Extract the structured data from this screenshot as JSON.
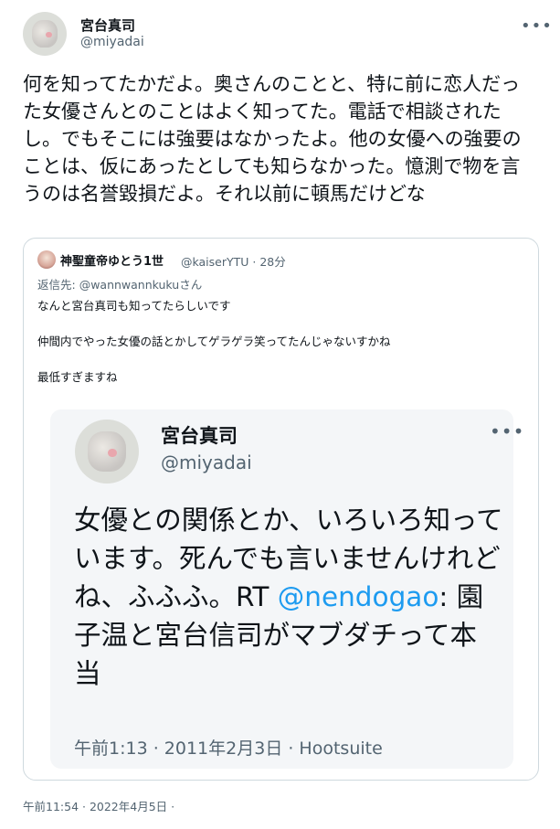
{
  "tweet": {
    "author_name": "宮台真司",
    "author_handle": "@miyadai",
    "more_icon": "more-icon",
    "text": "何を知ってたかだよ。奥さんのことと、特に前に恋人だった女優さんとのことはよく知ってた。電話で相談されたし。でもそこには強要はなかったよ。他の女優への強要のことは、仮にあったとしても知らなかった。憶測で物を言うのは名誉毀損だよ。それ以前に頓馬だけどな",
    "timestamp": "午前11:54 · 2022年4月5日 ·"
  },
  "quote": {
    "author_name": "神聖童帝ゆとう1世",
    "author_handle": "@kaiserYTU · 28分",
    "reply_prefix": "返信先: ",
    "reply_to": "@wannwannkukuさん",
    "line1": "なんと宮台真司も知ってたらしいです",
    "line2": "仲間内でやった女優の話とかしてゲラゲラ笑ってたんじゃないすかね",
    "line3": "最低すぎますね",
    "embedded": {
      "author_name": "宮台真司",
      "author_handle": "@miyadai",
      "text_before": "女優との関係とか、いろいろ知っています。死んでも言いませんけれどね、ふふふ。RT ",
      "mention": "@nendogao",
      "text_after": ": 園子温と宮台信司がマブダチって本当",
      "meta": "午前1:13 · 2011年2月3日 · Hootsuite"
    }
  },
  "colors": {
    "accent": "#1d9bf0",
    "secondary_text": "#536471",
    "border": "#cfd9de"
  }
}
